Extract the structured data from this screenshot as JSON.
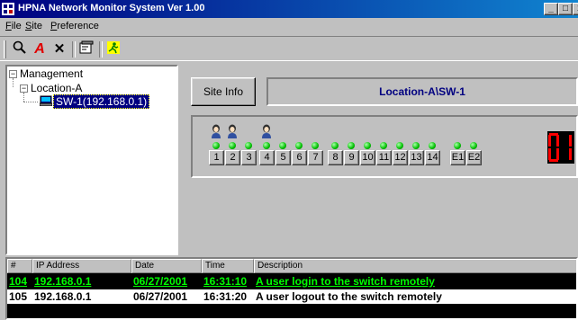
{
  "window": {
    "title": "HPNA Network Monitor System Ver 1.00",
    "min_glyph": "_",
    "max_glyph": "□",
    "close_glyph": "x"
  },
  "menu": {
    "file_accel": "F",
    "file_rest": "ile",
    "site_accel": "S",
    "site_rest": "ite",
    "pref_accel": "P",
    "pref_rest": "reference"
  },
  "toolbar": {
    "icons": [
      "search-icon",
      "font-icon",
      "delete-icon",
      "properties-icon",
      "run-icon"
    ],
    "font_glyph": "A",
    "delete_glyph": "✕"
  },
  "tree": {
    "root": "Management",
    "location": "Location-A",
    "switch": "SW-1(192.168.0.1)",
    "expander_minus": "−"
  },
  "panel": {
    "site_info_label": "Site Info",
    "location_path": "Location-A\\SW-1",
    "segment_value": "01"
  },
  "ports": {
    "labels": [
      "1",
      "2",
      "3",
      "4",
      "5",
      "6",
      "7",
      "8",
      "9",
      "10",
      "11",
      "12",
      "13",
      "14",
      "E1",
      "E2"
    ],
    "users_connected_ports": [
      "1",
      "2",
      "4"
    ],
    "link_led_color": "#00c000"
  },
  "log": {
    "columns": [
      "#",
      "IP Address",
      "Date",
      "Time",
      "Description"
    ],
    "rows": [
      {
        "num": "104",
        "ip": "192.168.0.1",
        "date": "06/27/2001",
        "time": "16:31:10",
        "desc": "A user login to the switch remotely",
        "color": "#00ff00"
      },
      {
        "num": "105",
        "ip": "192.168.0.1",
        "date": "06/27/2001",
        "time": "16:31:20",
        "desc": "A user logout to the switch remotely",
        "color": "#000000"
      }
    ]
  }
}
